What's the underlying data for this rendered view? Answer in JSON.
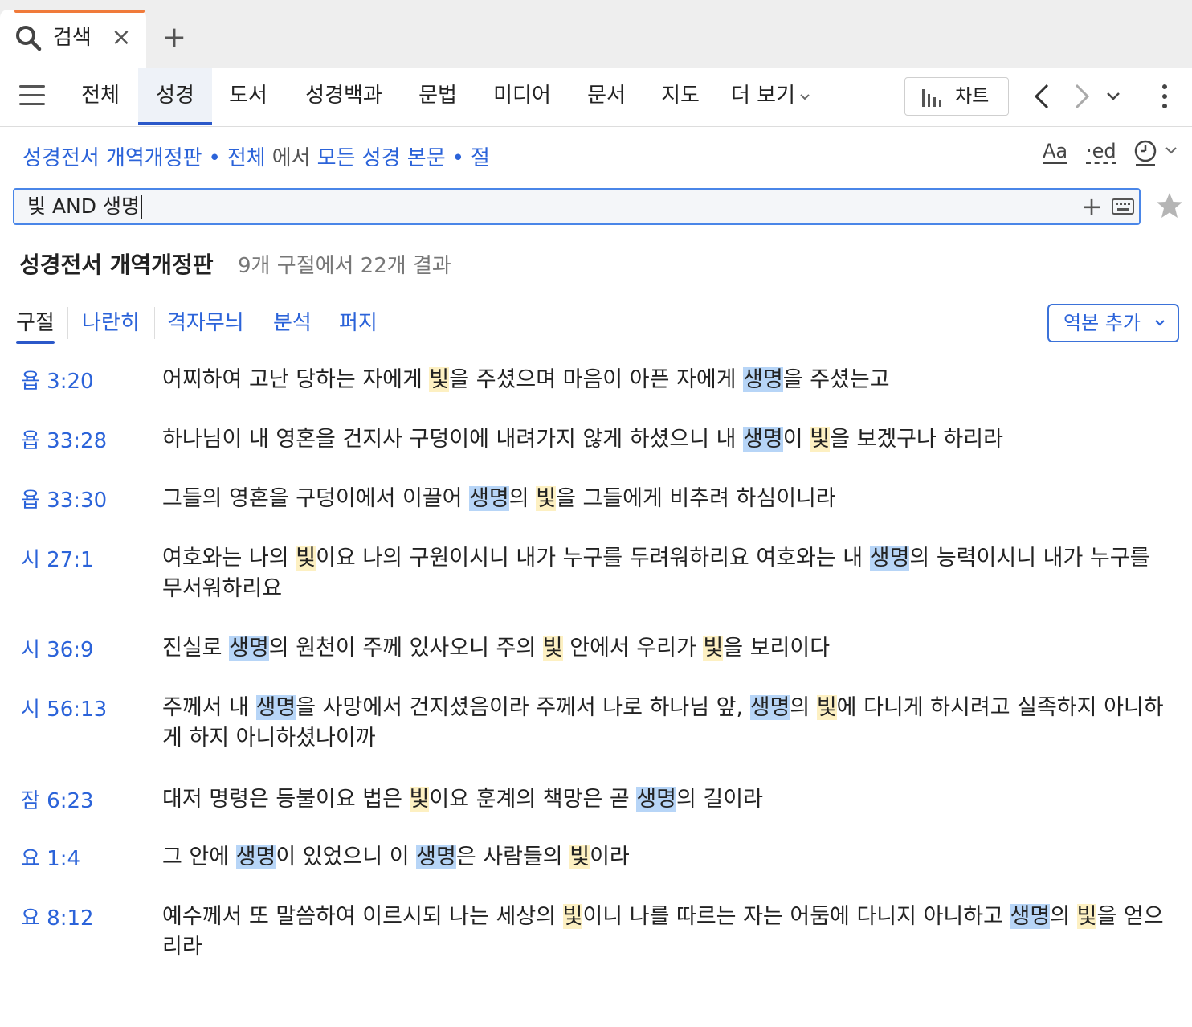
{
  "tab": {
    "label": "검색"
  },
  "nav": {
    "items": [
      "전체",
      "성경",
      "도서",
      "성경백과",
      "문법",
      "미디어",
      "문서",
      "지도",
      "더 보기"
    ],
    "active": "성경",
    "chart_label": "차트"
  },
  "scope": {
    "resource": "성경전서 개역개정판",
    "range": "전체",
    "in": "에서",
    "target": "모든 성경 본문",
    "unit": "절"
  },
  "tools": {
    "font": "Aa",
    "ed": "·ed"
  },
  "search": {
    "value": "빛 AND 생명"
  },
  "results": {
    "title": "성경전서 개역개정판",
    "count": "9개 구절에서 22개 결과"
  },
  "view_tabs": [
    "구절",
    "나란히",
    "격자무늬",
    "분석",
    "퍼지"
  ],
  "add_version_label": "역본 추가",
  "colors": {
    "accent": "#2b63d9",
    "tab_accent": "#f07a3a",
    "highlight_light": "#fdf0c2",
    "highlight_life": "#b7d5f7"
  },
  "verses": [
    {
      "ref": "욥 3:20",
      "segments": [
        [
          "어찌하여 고난 당하는 자에게 ",
          ""
        ],
        [
          "빛",
          "y"
        ],
        [
          "을 주셨으며 마음이 아픈 자에게 ",
          ""
        ],
        [
          "생명",
          "b"
        ],
        [
          "을 주셨는고",
          ""
        ]
      ]
    },
    {
      "ref": "욥 33:28",
      "segments": [
        [
          "하나님이 내 영혼을 건지사 구덩이에 내려가지 않게 하셨으니 내 ",
          ""
        ],
        [
          "생명",
          "b"
        ],
        [
          "이 ",
          ""
        ],
        [
          "빛",
          "y"
        ],
        [
          "을 보겠구나 하리라",
          ""
        ]
      ]
    },
    {
      "ref": "욥 33:30",
      "segments": [
        [
          "그들의 영혼을 구덩이에서 이끌어 ",
          ""
        ],
        [
          "생명",
          "b"
        ],
        [
          "의 ",
          ""
        ],
        [
          "빛",
          "y"
        ],
        [
          "을 그들에게 비추려 하심이니라",
          ""
        ]
      ]
    },
    {
      "ref": "시 27:1",
      "segments": [
        [
          "여호와는 나의 ",
          ""
        ],
        [
          "빛",
          "y"
        ],
        [
          "이요 나의 구원이시니 내가 누구를 두려워하리요 여호와는 내 ",
          ""
        ],
        [
          "생명",
          "b"
        ],
        [
          "의 능력이시니 내가 누구를 무서워하리요",
          ""
        ]
      ]
    },
    {
      "ref": "시 36:9",
      "segments": [
        [
          "진실로 ",
          ""
        ],
        [
          "생명",
          "b"
        ],
        [
          "의 원천이 주께 있사오니 주의 ",
          ""
        ],
        [
          "빛",
          "y"
        ],
        [
          " 안에서 우리가 ",
          ""
        ],
        [
          "빛",
          "y"
        ],
        [
          "을 보리이다",
          ""
        ]
      ]
    },
    {
      "ref": "시 56:13",
      "segments": [
        [
          "주께서 내 ",
          ""
        ],
        [
          "생명",
          "b"
        ],
        [
          "을 사망에서 건지셨음이라 주께서 나로 하나님 앞, ",
          ""
        ],
        [
          "생명",
          "b"
        ],
        [
          "의 ",
          ""
        ],
        [
          "빛",
          "y"
        ],
        [
          "에 다니게 하시려고 실족하지 아니하게 하지 아니하셨나이까",
          ""
        ]
      ]
    },
    {
      "ref": "잠 6:23",
      "segments": [
        [
          "대저 명령은 등불이요 법은 ",
          ""
        ],
        [
          "빛",
          "y"
        ],
        [
          "이요 훈계의 책망은 곧 ",
          ""
        ],
        [
          "생명",
          "b"
        ],
        [
          "의 길이라",
          ""
        ]
      ]
    },
    {
      "ref": "요 1:4",
      "segments": [
        [
          "그 안에 ",
          ""
        ],
        [
          "생명",
          "b"
        ],
        [
          "이 있었으니 이 ",
          ""
        ],
        [
          "생명",
          "b"
        ],
        [
          "은 사람들의 ",
          ""
        ],
        [
          "빛",
          "y"
        ],
        [
          "이라",
          ""
        ]
      ]
    },
    {
      "ref": "요 8:12",
      "segments": [
        [
          "예수께서 또 말씀하여 이르시되 나는 세상의 ",
          ""
        ],
        [
          "빛",
          "y"
        ],
        [
          "이니 나를 따르는 자는 어둠에 다니지 아니하고 ",
          ""
        ],
        [
          "생명",
          "b"
        ],
        [
          "의 ",
          ""
        ],
        [
          "빛",
          "y"
        ],
        [
          "을 얻으리라",
          ""
        ]
      ]
    }
  ]
}
